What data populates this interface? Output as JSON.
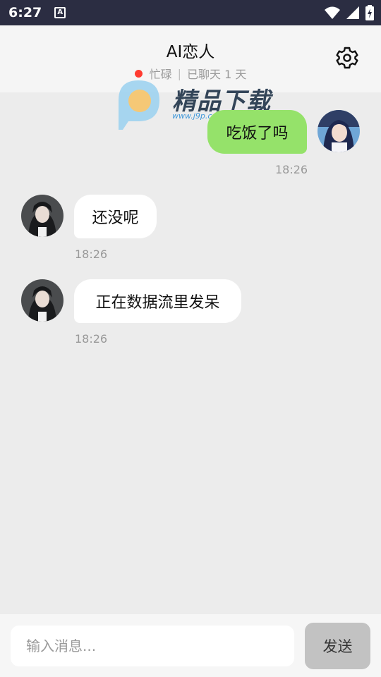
{
  "status_bar": {
    "time": "6:27",
    "notification_icon": "A"
  },
  "header": {
    "title": "AI恋人",
    "status_text": "忙碌",
    "divider": "|",
    "days_text": "已聊天 1 天"
  },
  "watermark": {
    "title": "精品下载",
    "url": "www.j9p.com"
  },
  "messages": [
    {
      "side": "right",
      "text": "吃饭了吗",
      "time": "18:26"
    },
    {
      "side": "left",
      "text": "还没呢",
      "time": "18:26"
    },
    {
      "side": "left",
      "text": "正在数据流里发呆",
      "time": "18:26"
    }
  ],
  "input": {
    "placeholder": "输入消息...",
    "send_label": "发送"
  },
  "colors": {
    "my_bubble": "#95e26a",
    "ai_bubble": "#ffffff",
    "status_dot": "#ff3b30",
    "send_button": "#c2c2c2"
  }
}
